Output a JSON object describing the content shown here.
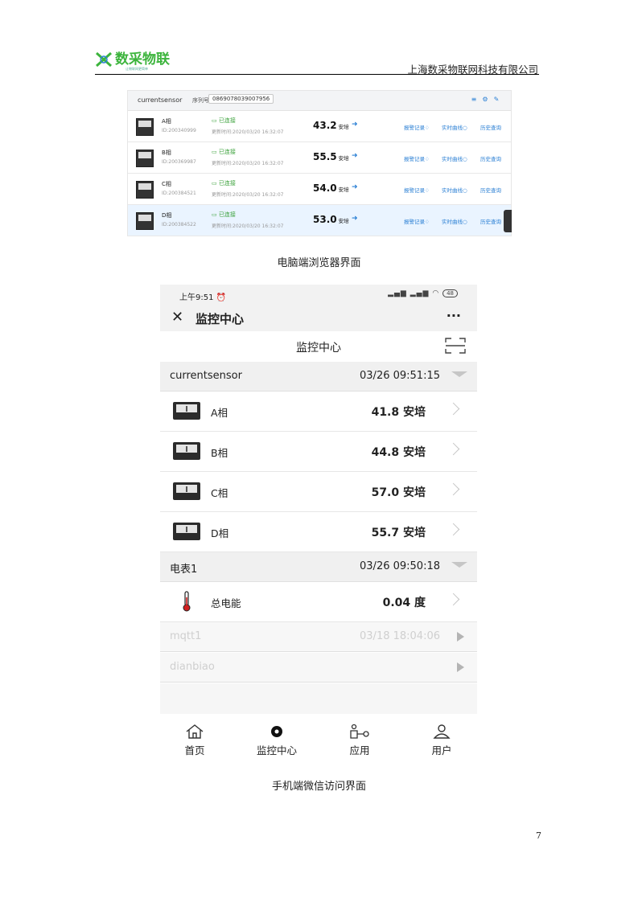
{
  "header": {
    "logo_text": "数采物联",
    "logo_subtext": "让物联网更简单",
    "company": "上海数采物联网科技有限公司"
  },
  "desktop": {
    "sensor_name": "currentsensor",
    "serial_label": "序列号:",
    "serial_value": "0869078039007956",
    "rows": [
      {
        "name": "A相",
        "id": "ID:200340999",
        "status": "已连接",
        "updated": "更新时间:2020/03/20 16:32:07",
        "value": "43.2",
        "unit": "安培",
        "alarm": "报警记录",
        "realtime": "实时曲线",
        "history": "历史查询"
      },
      {
        "name": "B相",
        "id": "ID:200369987",
        "status": "已连接",
        "updated": "更新时间:2020/03/20 16:32:07",
        "value": "55.5",
        "unit": "安培",
        "alarm": "报警记录",
        "realtime": "实时曲线",
        "history": "历史查询"
      },
      {
        "name": "C相",
        "id": "ID:200384521",
        "status": "已连接",
        "updated": "更新时间:2020/03/20 16:32:07",
        "value": "54.0",
        "unit": "安培",
        "alarm": "报警记录",
        "realtime": "实时曲线",
        "history": "历史查询"
      },
      {
        "name": "D相",
        "id": "ID:200384522",
        "status": "已连接",
        "updated": "更新时间:2020/03/20 16:32:07",
        "value": "53.0",
        "unit": "安培",
        "alarm": "报警记录",
        "realtime": "实时曲线",
        "history": "历史查询"
      }
    ]
  },
  "caption_desktop": "电脑端浏览器界面",
  "phone": {
    "status_time": "上午9:51",
    "status_battery": "48",
    "wx_title": "监控中心",
    "page_title": "监控中心",
    "groups": [
      {
        "name": "currentsensor",
        "time": "03/26 09:51:15"
      },
      {
        "name": "电表1",
        "time": "03/26 09:50:18"
      },
      {
        "name": "mqtt1",
        "time": "03/18 18:04:06"
      },
      {
        "name": "dianbiao",
        "time": ""
      }
    ],
    "rows": [
      {
        "name": "A相",
        "value": "41.8 安培"
      },
      {
        "name": "B相",
        "value": "44.8 安培"
      },
      {
        "name": "C相",
        "value": "57.0 安培"
      },
      {
        "name": "D相",
        "value": "55.7 安培"
      },
      {
        "name": "总电能",
        "value": "0.04 度"
      }
    ],
    "tabs": [
      {
        "label": "首页",
        "icon": "home-icon"
      },
      {
        "label": "监控中心",
        "icon": "monitor-icon"
      },
      {
        "label": "应用",
        "icon": "app-icon"
      },
      {
        "label": "用户",
        "icon": "user-icon"
      }
    ]
  },
  "caption_phone": "手机端微信访问界面",
  "page_number": "7",
  "colors": {
    "logo_green": "#3cb43c",
    "link_blue": "#2a7fd4",
    "connected_green": "#3aa13a"
  }
}
